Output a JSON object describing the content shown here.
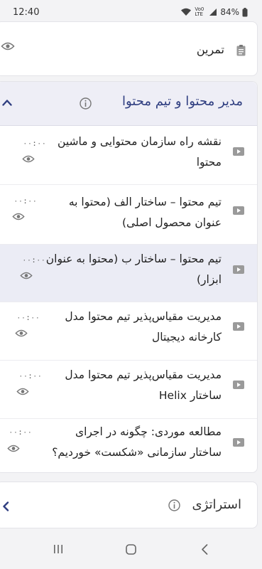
{
  "status": {
    "time": "12:40",
    "network": "Vo0 LTE",
    "battery": "84%"
  },
  "practice": {
    "label": "تمرین"
  },
  "section": {
    "title": "مدیر محتوا و تیم محتوا",
    "lessons": [
      {
        "title": "نقشه راه سازمان محتوایی و ماشین محتوا",
        "duration": "۰۰:۰۰"
      },
      {
        "title": "تیم محتوا – ساختار الف (محتوا به عنوان محصول اصلی)",
        "duration": "۰۰:۰۰"
      },
      {
        "title": "تیم محتوا – ساختار ب (محتوا به عنوان ابزار)",
        "duration": "۰۰:۰۰"
      },
      {
        "title": "مدیریت مقیاس‌پذیر تیم محتوا مدل کارخانه دیجیتال",
        "duration": "۰۰:۰۰"
      },
      {
        "title": "مدیریت مقیاس‌پذیر تیم محتوا مدل ساختار Helix",
        "duration": "۰۰:۰۰"
      },
      {
        "title": "مطالعه موردی: چگونه در اجرای ساختار سازمانی «شکست» خوردیم؟",
        "duration": "۰۰:۰۰"
      }
    ]
  },
  "next_section": {
    "title": "استراتژی"
  },
  "colors": {
    "accent": "#2f3e80",
    "active_row": "#ebecf5",
    "header_bg": "#eeeef6"
  }
}
